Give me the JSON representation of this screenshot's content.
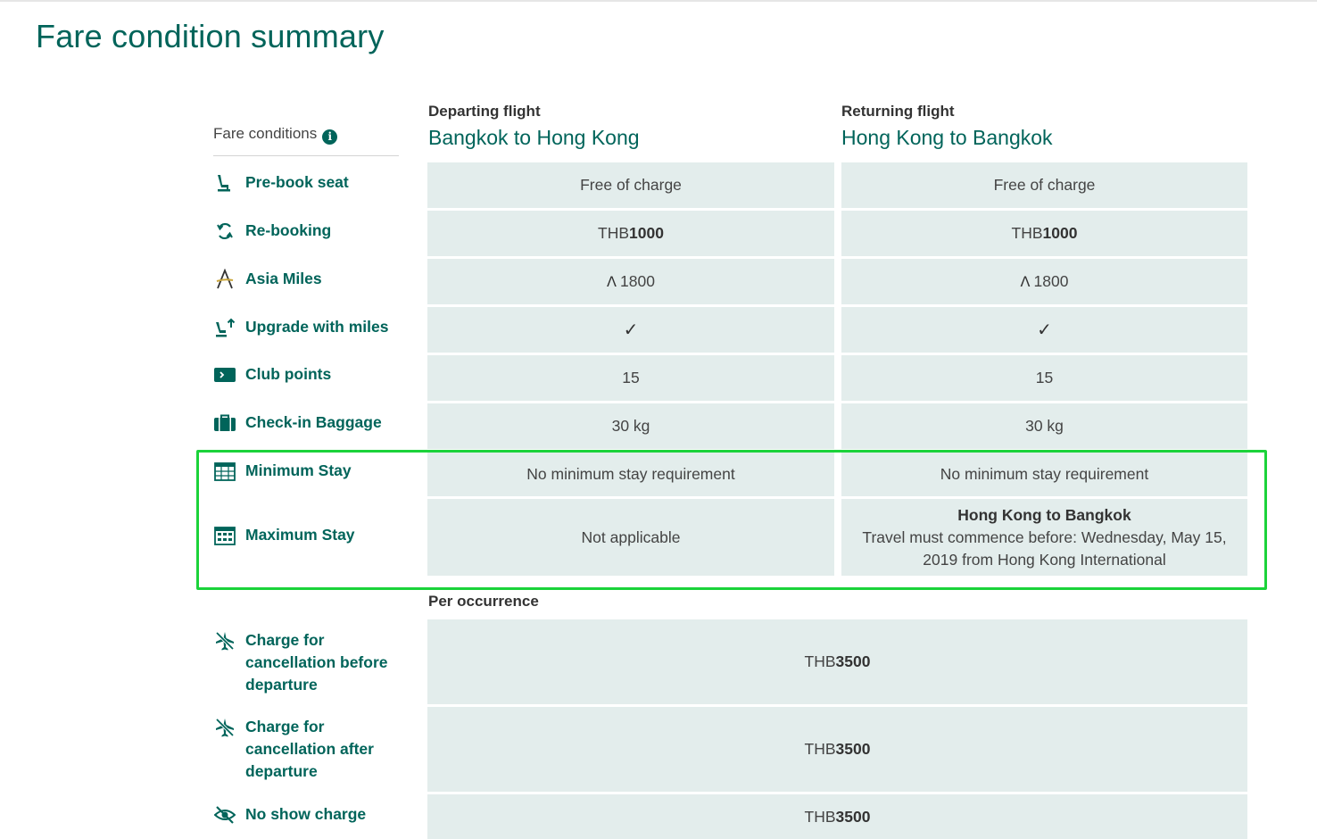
{
  "page_title": "Fare condition summary",
  "fare_conditions_label": "Fare conditions",
  "info_glyph": "i",
  "columns": {
    "departing": {
      "sub": "Departing flight",
      "route": "Bangkok to Hong Kong"
    },
    "returning": {
      "sub": "Returning flight",
      "route": "Hong Kong to Bangkok"
    }
  },
  "rows": {
    "prebook_seat": {
      "label": "Pre-book seat",
      "icon": "seat-icon",
      "dep": "Free of charge",
      "ret": "Free of charge"
    },
    "rebooking": {
      "label": "Re-booking",
      "icon": "refresh-icon",
      "dep_currency": "THB",
      "dep_amount": "1000",
      "ret_currency": "THB",
      "ret_amount": "1000"
    },
    "asia_miles": {
      "label": "Asia Miles",
      "icon": "asia-miles-icon",
      "glyph": "Λ",
      "dep": "1800",
      "ret": "1800"
    },
    "upgrade": {
      "label": "Upgrade with miles",
      "icon": "seat-upgrade-icon",
      "dep": "✓",
      "ret": "✓"
    },
    "club_points": {
      "label": "Club points",
      "icon": "club-card-icon",
      "dep": "15",
      "ret": "15"
    },
    "baggage": {
      "label": "Check-in Baggage",
      "icon": "suitcase-icon",
      "dep": "30 kg",
      "ret": "30 kg"
    },
    "min_stay": {
      "label": "Minimum Stay",
      "icon": "calendar-icon",
      "dep": "No minimum stay requirement",
      "ret": "No minimum stay requirement"
    },
    "max_stay": {
      "label": "Maximum Stay",
      "icon": "calendar-grid-icon",
      "dep": "Not applicable",
      "ret_title": "Hong Kong to Bangkok",
      "ret_text": "Travel must commence before: Wednesday, May 15, 2019 from Hong Kong International"
    }
  },
  "per_occurrence_label": "Per occurrence",
  "charges": {
    "cancel_before": {
      "label": "Charge for cancellation before departure",
      "icon": "plane-cancel-icon",
      "currency": "THB",
      "amount": "3500"
    },
    "cancel_after": {
      "label": "Charge for cancellation after departure",
      "icon": "plane-cancel-icon",
      "currency": "THB",
      "amount": "3500"
    },
    "no_show": {
      "label": "No show charge",
      "icon": "eye-slash-icon",
      "currency": "THB",
      "amount": "3500"
    }
  },
  "colors": {
    "brand": "#00645a",
    "cell_bg": "#e3edec",
    "highlight": "#1bd33a"
  }
}
